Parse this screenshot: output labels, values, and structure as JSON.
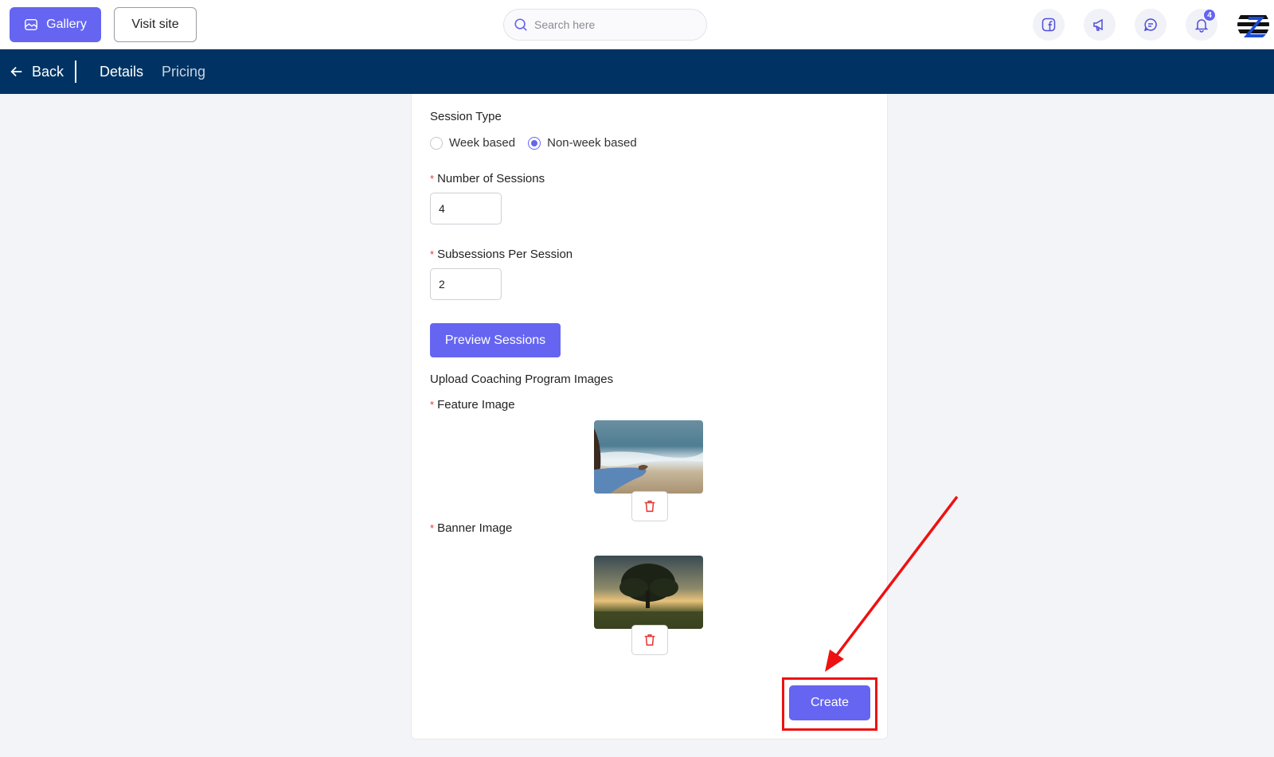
{
  "header": {
    "gallery_label": "Gallery",
    "visit_site_label": "Visit site",
    "search_placeholder": "Search here",
    "notification_count": "4"
  },
  "subnav": {
    "back_label": "Back",
    "tabs": [
      {
        "label": "Details"
      },
      {
        "label": "Pricing"
      }
    ]
  },
  "form": {
    "session_type_label": "Session Type",
    "session_type_options": [
      "Week based",
      "Non-week based"
    ],
    "session_type_selected": "Non-week based",
    "num_sessions_label": "Number of Sessions",
    "num_sessions_value": "4",
    "subsessions_label": "Subsessions Per Session",
    "subsessions_value": "2",
    "preview_button": "Preview Sessions",
    "upload_heading": "Upload Coaching Program Images",
    "feature_image_label": "Feature Image",
    "banner_image_label": "Banner Image",
    "create_button": "Create",
    "required_mark": "*"
  },
  "colors": {
    "accent": "#6565f2",
    "navy": "#003363",
    "danger": "#e53935",
    "annotation": "#ee1111"
  }
}
